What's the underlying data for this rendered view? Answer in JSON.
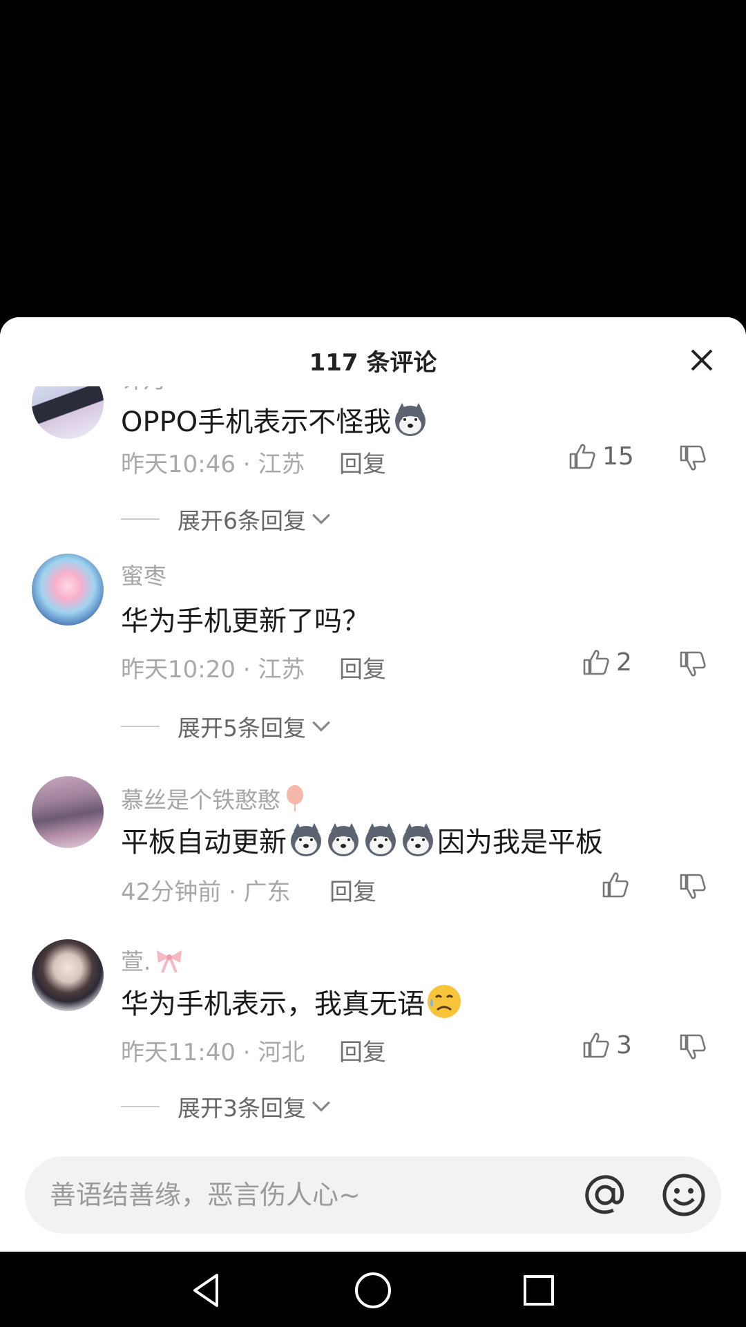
{
  "sheet": {
    "title": "117 条评论"
  },
  "comments": [
    {
      "username": "许月",
      "text": "OPPO手机表示不怪我",
      "emojis": [
        "husky-emoji"
      ],
      "time_location": "昨天10:46 · 江苏",
      "reply_label": "回复",
      "likes": "15",
      "expand_label": "展开6条回复"
    },
    {
      "username": "蜜枣",
      "text": "华为手机更新了吗？",
      "emojis": [],
      "time_location": "昨天10:20 · 江苏",
      "reply_label": "回复",
      "likes": "2",
      "expand_label": "展开5条回复"
    },
    {
      "username": "慕丝是个铁憨憨",
      "text_before": "平板自动更新",
      "text_after": "因为我是平板",
      "emojis": [
        "husky-emoji",
        "husky-emoji",
        "husky-emoji",
        "husky-emoji"
      ],
      "time_location": "42分钟前 · 广东",
      "reply_label": "回复",
      "likes": ""
    },
    {
      "username": "萱.",
      "text": "华为手机表示，我真无语",
      "emojis": [
        "sweat-face-emoji"
      ],
      "time_location": "昨天11:40 · 河北",
      "reply_label": "回复",
      "likes": "3",
      "expand_label": "展开3条回复"
    }
  ],
  "input": {
    "placeholder": "善语结善缘，恶言伤人心~"
  },
  "icons": {
    "close": "close-icon",
    "like": "thumb-up-icon",
    "dislike": "thumb-down-icon",
    "at": "at-icon",
    "emoji": "smiley-icon",
    "nav_back": "back-triangle-icon",
    "nav_home": "home-circle-icon",
    "nav_recents": "recents-square-icon"
  },
  "colors": {
    "sheet_bg": "#ffffff",
    "muted_text": "#a6a6a6",
    "input_bg": "#f2f2f2"
  }
}
